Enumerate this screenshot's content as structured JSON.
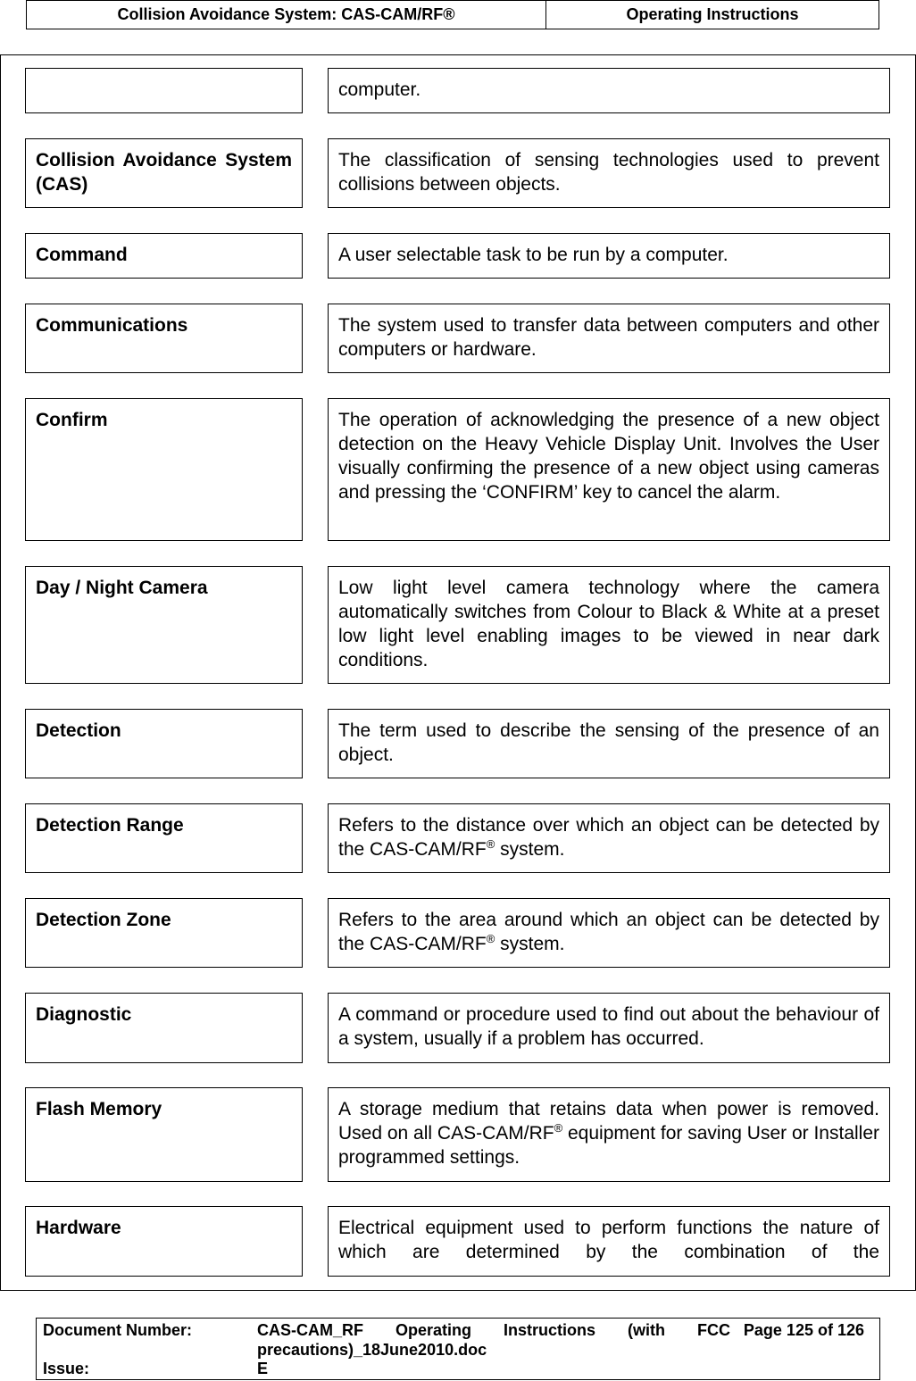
{
  "header": {
    "title": "Collision Avoidance System: CAS-CAM/RF®",
    "section": "Operating Instructions"
  },
  "glossary": [
    {
      "term": "",
      "definition": "computer."
    },
    {
      "term": "Collision Avoidance System (CAS)",
      "definition": "The classification of sensing technologies used to prevent collisions between objects."
    },
    {
      "term": "Command",
      "definition": "A user selectable task to be run by a computer."
    },
    {
      "term": "Communications",
      "definition": "The system used to transfer data between computers and other computers or hardware."
    },
    {
      "term": "Confirm",
      "definition": "The operation of acknowledging the presence of a new object detection on the Heavy Vehicle Display Unit. Involves the User visually confirming the presence of a new object using cameras and pressing the ‘CONFIRM’ key to cancel the alarm."
    },
    {
      "term": "Day / Night Camera",
      "definition": "Low light level camera technology where the camera automatically switches from Colour to Black & White at a preset low light level enabling images to be viewed in near dark conditions."
    },
    {
      "term": "Detection",
      "definition": "The term used to describe the sensing of the presence of an object."
    },
    {
      "term": "Detection Range",
      "definition_pre": "Refers to the distance over which an object can be detected by the CAS-CAM/RF",
      "definition_sup": "®",
      "definition_post": " system."
    },
    {
      "term": "Detection Zone",
      "definition_pre": "Refers to the area around which an object can be detected by the CAS-CAM/RF",
      "definition_sup": "®",
      "definition_post": " system."
    },
    {
      "term": "Diagnostic",
      "definition": "A command or procedure used to find out about the behaviour of a system, usually if a problem has occurred."
    },
    {
      "term": "Flash Memory",
      "definition_pre": "A storage medium that retains data when power is removed.  Used on all CAS-CAM/RF",
      "definition_sup": "®",
      "definition_post": " equipment for saving User or Installer programmed settings."
    },
    {
      "term": "Hardware",
      "definition": "Electrical equipment used to perform functions the nature of which are determined by the combination of the"
    }
  ],
  "footer": {
    "doc_number_label": "Document Number:",
    "doc_number_value": "CAS-CAM_RF Operating Instructions (with FCC precautions)_18June2010.doc",
    "page": "Page 125 of  126",
    "issue_label": "Issue:",
    "issue_value": "E"
  }
}
